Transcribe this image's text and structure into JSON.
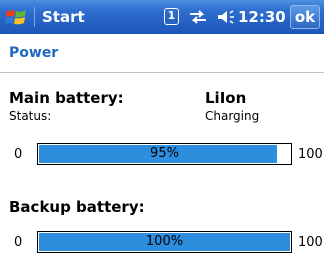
{
  "titlebar": {
    "title": "Start",
    "indicator_one": "1",
    "time": "12:30",
    "ok_label": "ok"
  },
  "page": {
    "header": "Power"
  },
  "main_battery": {
    "label": "Main battery:",
    "type": "LiIon",
    "status_label": "Status:",
    "status_value": "Charging",
    "min_label": "0",
    "max_label": "100",
    "percent_text": "95%",
    "percent": 95
  },
  "backup_battery": {
    "label": "Backup battery:",
    "min_label": "0",
    "max_label": "100",
    "percent_text": "100%",
    "percent": 100
  },
  "colors": {
    "titlebar": "#2f6fcf",
    "header_text": "#1f6ac0",
    "bar_fill": "#2e8ede"
  }
}
